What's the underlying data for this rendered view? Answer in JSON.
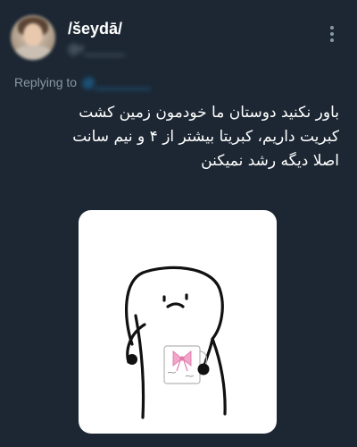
{
  "header": {
    "display_name": "/šeydā/",
    "handle": "@r_______",
    "more_icon": "more-vertical-icon"
  },
  "reply": {
    "prefix": "Replying to",
    "mention": "@________"
  },
  "tweet": {
    "lines": [
      "باور نکنید دوستان ما خودمون زمین کشت",
      "کبریت داریم، کبریتا بیشتر از ۴ و نیم سانت",
      "اصلا دیگه رشد نمیکنن"
    ]
  },
  "media": {
    "icon": "flork-meme-drawing"
  },
  "colors": {
    "background": "#1c2733",
    "secondary_text": "#8899a6",
    "accent": "#1d9bf0"
  }
}
